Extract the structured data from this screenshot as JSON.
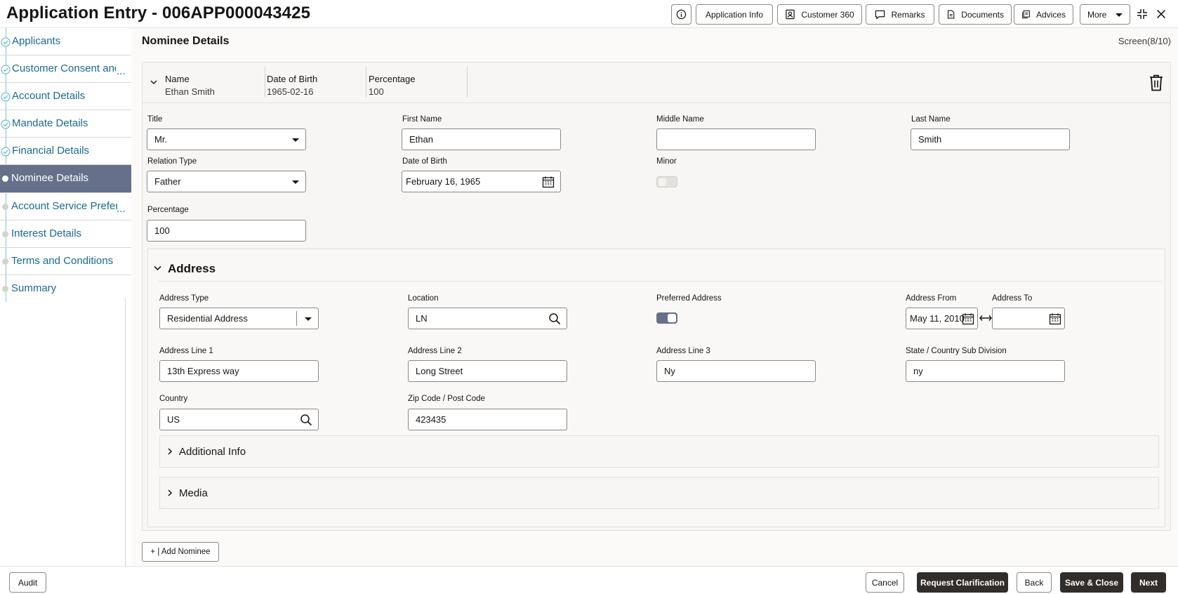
{
  "header": {
    "title": "Application Entry - 006APP000043425",
    "buttons": {
      "info_icon": "info-icon",
      "application_info": "Application Info",
      "customer_360": "Customer 360",
      "remarks": "Remarks",
      "documents": "Documents",
      "advices": "Advices",
      "more": "More"
    }
  },
  "sidebar": {
    "items": [
      {
        "label": "Applicants",
        "state": "done"
      },
      {
        "label": "Customer Consent and",
        "state": "done",
        "more": "..."
      },
      {
        "label": "Account Details",
        "state": "done"
      },
      {
        "label": "Mandate Details",
        "state": "done"
      },
      {
        "label": "Financial Details",
        "state": "done"
      },
      {
        "label": "Nominee Details",
        "state": "active"
      },
      {
        "label": "Account Service Prefere",
        "state": "pending",
        "more": "..."
      },
      {
        "label": "Interest Details",
        "state": "pending"
      },
      {
        "label": "Terms and Conditions",
        "state": "pending"
      },
      {
        "label": "Summary",
        "state": "pending"
      }
    ]
  },
  "main": {
    "title": "Nominee Details",
    "screen": "Screen(8/10)",
    "summary": {
      "name_label": "Name",
      "name_value": "Ethan Smith",
      "dob_label": "Date of Birth",
      "dob_value": "1965-02-16",
      "pct_label": "Percentage",
      "pct_value": "100"
    },
    "form": {
      "title_label": "Title",
      "title_value": "Mr.",
      "first_name_label": "First Name",
      "first_name_value": "Ethan",
      "middle_name_label": "Middle Name",
      "middle_name_value": "",
      "last_name_label": "Last Name",
      "last_name_value": "Smith",
      "relation_label": "Relation Type",
      "relation_value": "Father",
      "dob_label": "Date of Birth",
      "dob_value": "February 16, 1965",
      "minor_label": "Minor",
      "minor_on": false,
      "percentage_label": "Percentage",
      "percentage_value": "100"
    },
    "address": {
      "title": "Address",
      "type_label": "Address Type",
      "type_value": "Residential Address",
      "location_label": "Location",
      "location_value": "LN",
      "preferred_label": "Preferred Address",
      "preferred_on": true,
      "from_label": "Address From",
      "from_value": "May 11, 2010",
      "to_label": "Address To",
      "to_value": "",
      "line1_label": "Address Line 1",
      "line1_value": "13th Express way",
      "line2_label": "Address Line 2",
      "line2_value": "Long Street",
      "line3_label": "Address Line 3",
      "line3_value": "Ny",
      "state_label": "State / Country Sub Division",
      "state_value": "ny",
      "country_label": "Country",
      "country_value": "US",
      "zip_label": "Zip Code / Post Code",
      "zip_value": "423435",
      "additional_info": "Additional Info",
      "media": "Media"
    },
    "add_nominee": "+ | Add Nominee"
  },
  "footer": {
    "audit": "Audit",
    "cancel": "Cancel",
    "request_clarification": "Request Clarification",
    "back": "Back",
    "save_close": "Save & Close",
    "next": "Next"
  },
  "colors": {
    "accent": "#67708a",
    "link": "#1a6a8f",
    "primary_button": "#312d2a"
  }
}
